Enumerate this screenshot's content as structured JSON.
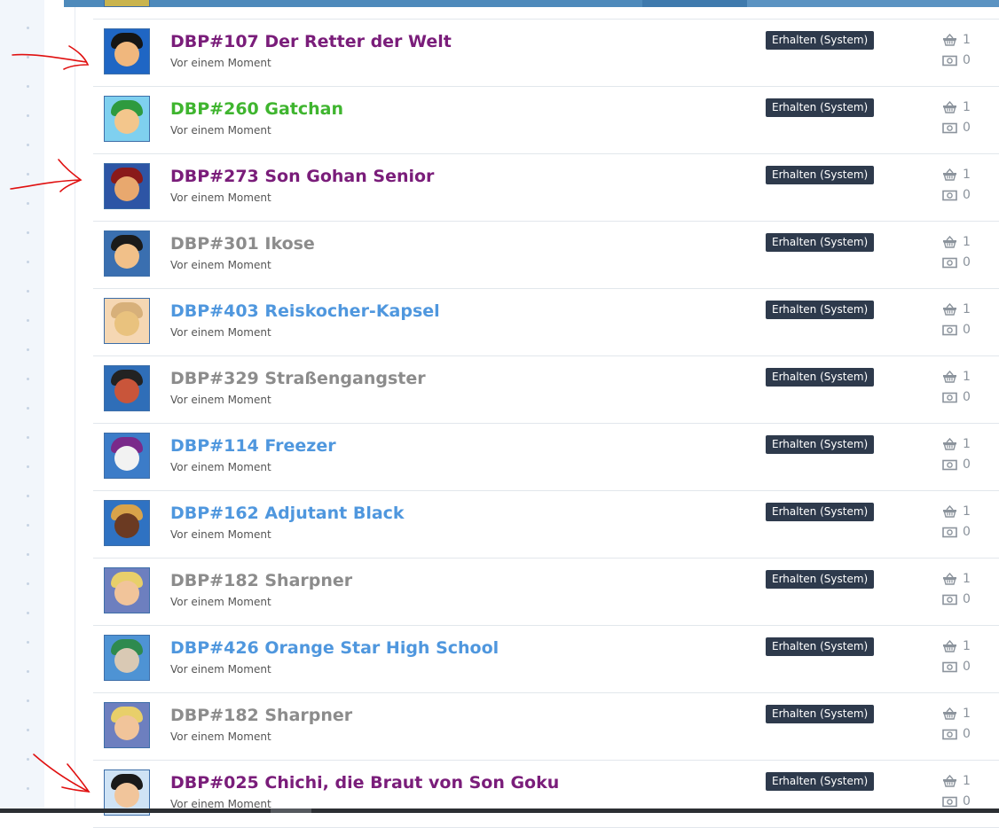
{
  "colors": {
    "title_purple": "#7a1d7a",
    "title_green": "#3fb52f",
    "title_gray": "#8c8c8c",
    "title_blue": "#4f97de",
    "badge_bg": "#2e3a4c",
    "annotation_red": "#e01010"
  },
  "items": [
    {
      "title": "DBP#107 Der Retter der Welt",
      "time": "Vor einem Moment",
      "status": "Erhalten (System)",
      "quantity": "1",
      "price": "0",
      "title_color": "#7a1d7a",
      "thumb": {
        "bg": "#1f66c4",
        "skin": "#f0b77d",
        "hair": "#151515"
      },
      "annotated": true
    },
    {
      "title": "DBP#260 Gatchan",
      "time": "Vor einem Moment",
      "status": "Erhalten (System)",
      "quantity": "1",
      "price": "0",
      "title_color": "#3fb52f",
      "thumb": {
        "bg": "#7fd0ef",
        "skin": "#f3c68c",
        "hair": "#2e9a3e"
      },
      "annotated": false
    },
    {
      "title": "DBP#273 Son Gohan Senior",
      "time": "Vor einem Moment",
      "status": "Erhalten (System)",
      "quantity": "1",
      "price": "0",
      "title_color": "#7a1d7a",
      "thumb": {
        "bg": "#2d55a5",
        "skin": "#e8a86e",
        "hair": "#8a1a1a"
      },
      "annotated": true
    },
    {
      "title": "DBP#301 Ikose",
      "time": "Vor einem Moment",
      "status": "Erhalten (System)",
      "quantity": "1",
      "price": "0",
      "title_color": "#8c8c8c",
      "thumb": {
        "bg": "#3a6fb0",
        "skin": "#f1c089",
        "hair": "#1a1a1a"
      },
      "annotated": false
    },
    {
      "title": "DBP#403 Reiskocher-Kapsel",
      "time": "Vor einem Moment",
      "status": "Erhalten (System)",
      "quantity": "1",
      "price": "0",
      "title_color": "#4f97de",
      "thumb": {
        "bg": "#f5d7b3",
        "skin": "#e9c27e",
        "hair": "#d7b07a"
      },
      "annotated": false
    },
    {
      "title": "DBP#329 Straßengangster",
      "time": "Vor einem Moment",
      "status": "Erhalten (System)",
      "quantity": "1",
      "price": "0",
      "title_color": "#8c8c8c",
      "thumb": {
        "bg": "#2f6eb8",
        "skin": "#c9553a",
        "hair": "#222222"
      },
      "annotated": false
    },
    {
      "title": "DBP#114 Freezer",
      "time": "Vor einem Moment",
      "status": "Erhalten (System)",
      "quantity": "1",
      "price": "0",
      "title_color": "#4f97de",
      "thumb": {
        "bg": "#3c7cc8",
        "skin": "#f2f2f2",
        "hair": "#7a2a8a"
      },
      "annotated": false
    },
    {
      "title": "DBP#162 Adjutant Black",
      "time": "Vor einem Moment",
      "status": "Erhalten (System)",
      "quantity": "1",
      "price": "0",
      "title_color": "#4f97de",
      "thumb": {
        "bg": "#2f72c2",
        "skin": "#6b3a22",
        "hair": "#d8a34a"
      },
      "annotated": false
    },
    {
      "title": "DBP#182 Sharpner",
      "time": "Vor einem Moment",
      "status": "Erhalten (System)",
      "quantity": "1",
      "price": "0",
      "title_color": "#8c8c8c",
      "thumb": {
        "bg": "#6d7fbf",
        "skin": "#f1c49a",
        "hair": "#e8cf6a"
      },
      "annotated": false
    },
    {
      "title": "DBP#426 Orange Star High School",
      "time": "Vor einem Moment",
      "status": "Erhalten (System)",
      "quantity": "1",
      "price": "0",
      "title_color": "#4f97de",
      "thumb": {
        "bg": "#4e93d4",
        "skin": "#d9c9b4",
        "hair": "#2e8a4e"
      },
      "annotated": false
    },
    {
      "title": "DBP#182 Sharpner",
      "time": "Vor einem Moment",
      "status": "Erhalten (System)",
      "quantity": "1",
      "price": "0",
      "title_color": "#8c8c8c",
      "thumb": {
        "bg": "#6d7fbf",
        "skin": "#f1c49a",
        "hair": "#e8cf6a"
      },
      "annotated": false
    },
    {
      "title": "DBP#025 Chichi, die Braut von Son Goku",
      "time": "Vor einem Moment",
      "status": "Erhalten (System)",
      "quantity": "1",
      "price": "0",
      "title_color": "#7a1d7a",
      "thumb": {
        "bg": "#cfe3f5",
        "skin": "#f1c59b",
        "hair": "#1a1a1a"
      },
      "annotated": true
    }
  ]
}
